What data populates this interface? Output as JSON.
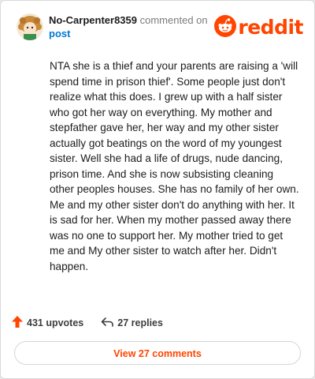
{
  "header": {
    "username": "No-Carpenter8359",
    "commented_on": "commented on",
    "post_link": "post",
    "logo_text": "reddit"
  },
  "comment": {
    "body": "NTA she is a thief and your parents are raising a 'will spend time in prison thief'. Some people just don't realize what this does. I grew up with a half sister who got her way on everything. My mother and stepfather gave her, her way and my other sister actually got beatings on the word of my youngest sister. Well she had a life of drugs, nude dancing, prison time. And she is now subsisting cleaning other peoples houses. She has no family of her own. Me and my other sister don't do anything with her. It is sad for her. When my mother passed away there was no one to support her. My mother tried to get me and My other sister to watch after her. Didn't happen."
  },
  "stats": {
    "upvotes": "431 upvotes",
    "replies": "27 replies"
  },
  "footer": {
    "view_comments_label": "View 27 comments"
  },
  "colors": {
    "brand": "#ff4500",
    "link": "#0079d3",
    "text": "#1c1c1c"
  },
  "icons": {
    "avatar": "avatar",
    "logo": "reddit-snoo-icon",
    "upvote": "upvote-arrow-icon",
    "reply": "reply-arrow-icon"
  }
}
